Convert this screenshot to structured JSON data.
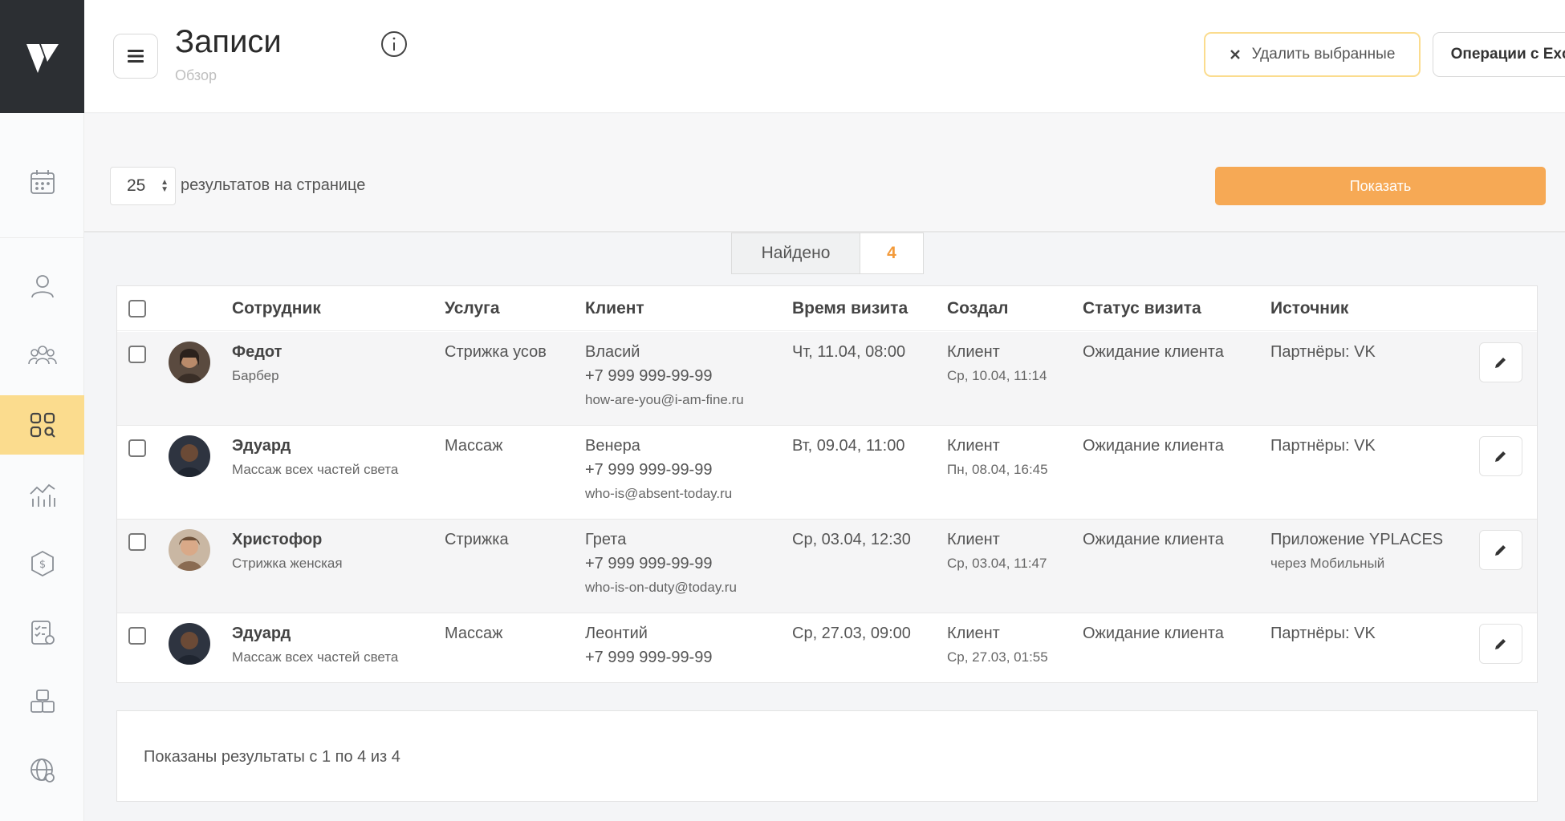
{
  "header": {
    "title": "Записи",
    "subtitle": "Обзор",
    "delete_label": "Удалить выбранные",
    "excel_label": "Операции с Excel"
  },
  "sidebar": {
    "items": [
      {
        "icon": "calendar-icon"
      },
      {
        "icon": "user-icon"
      },
      {
        "icon": "users-group-icon"
      },
      {
        "icon": "records-grid-icon",
        "active": true
      },
      {
        "icon": "analytics-icon"
      },
      {
        "icon": "finance-icon"
      },
      {
        "icon": "checklist-icon"
      },
      {
        "icon": "warehouse-icon"
      },
      {
        "icon": "globe-icon"
      }
    ]
  },
  "filter": {
    "per_page": "25",
    "per_page_label": "результатов на странице",
    "show_label": "Показать"
  },
  "found": {
    "label": "Найдено",
    "count": "4"
  },
  "table": {
    "columns": [
      "Сотрудник",
      "Услуга",
      "Клиент",
      "Время визита",
      "Создал",
      "Статус визита",
      "Источник"
    ],
    "rows": [
      {
        "employee": "Федот",
        "role": "Барбер",
        "service": "Стрижка усов",
        "client_name": "Власий",
        "client_phone": "+7 999 999-99-99",
        "client_email": "how-are-you@i-am-fine.ru",
        "visit_time": "Чт, 11.04, 08:00",
        "created_by": "Клиент",
        "created_at": "Ср, 10.04, 11:14",
        "status": "Ожидание клиента",
        "source": "Партнёры: VK",
        "source_sub": ""
      },
      {
        "employee": "Эдуард",
        "role": "Массаж всех частей света",
        "service": "Массаж",
        "client_name": "Венера",
        "client_phone": "+7 999 999-99-99",
        "client_email": "who-is@absent-today.ru",
        "visit_time": "Вт, 09.04, 11:00",
        "created_by": "Клиент",
        "created_at": "Пн, 08.04, 16:45",
        "status": "Ожидание клиента",
        "source": "Партнёры: VK",
        "source_sub": ""
      },
      {
        "employee": "Христофор",
        "role": "Стрижка женская",
        "service": "Стрижка",
        "client_name": "Грета",
        "client_phone": "+7 999 999-99-99",
        "client_email": "who-is-on-duty@today.ru",
        "visit_time": "Ср, 03.04, 12:30",
        "created_by": "Клиент",
        "created_at": "Ср, 03.04, 11:47",
        "status": "Ожидание клиента",
        "source": "Приложение YPLACES",
        "source_sub": "через Мобильный"
      },
      {
        "employee": "Эдуард",
        "role": "Массаж всех частей света",
        "service": "Массаж",
        "client_name": "Леонтий",
        "client_phone": "+7 999 999-99-99",
        "client_email": "",
        "visit_time": "Ср, 27.03, 09:00",
        "created_by": "Клиент",
        "created_at": "Ср, 27.03, 01:55",
        "status": "Ожидание клиента",
        "source": "Партнёры: VK",
        "source_sub": ""
      }
    ]
  },
  "footer": {
    "text": "Показаны результаты с 1 по 4 из 4"
  },
  "colors": {
    "accent": "#f6a955",
    "active_nav": "#fbdc8e",
    "sidebar_logo_bg": "#2c2f33"
  }
}
